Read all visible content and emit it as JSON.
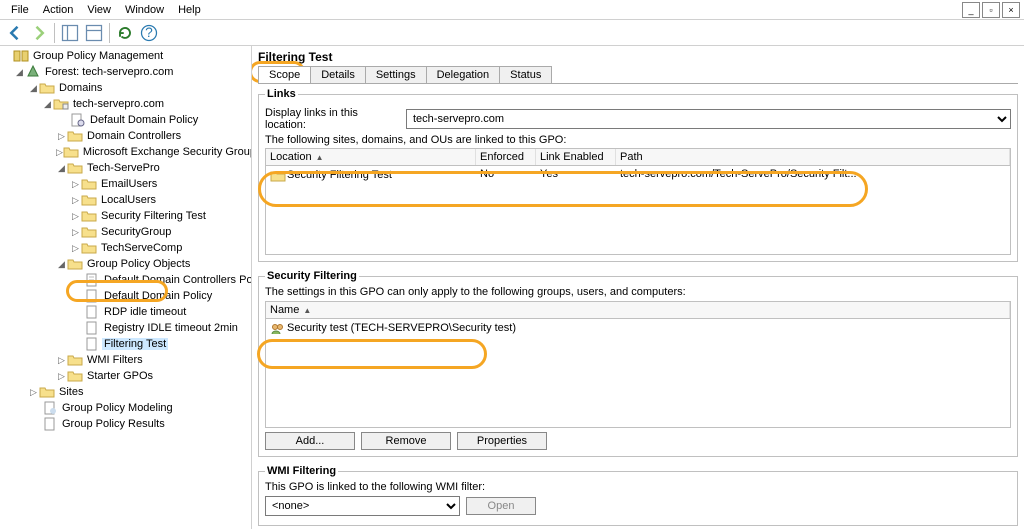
{
  "menu": {
    "file": "File",
    "action": "Action",
    "view": "View",
    "window": "Window",
    "help": "Help"
  },
  "tree": {
    "root": "Group Policy Management",
    "forest": "Forest: tech-servepro.com",
    "domains": "Domains",
    "domain": "tech-servepro.com",
    "default_policy": "Default Domain Policy",
    "dc": "Domain Controllers",
    "mesg": "Microsoft Exchange Security Groups",
    "techservepro": "Tech-ServePro",
    "emailusers": "EmailUsers",
    "localusers": "LocalUsers",
    "sft": "Security Filtering Test",
    "securitygroup": "SecurityGroup",
    "techservecomp": "TechServeComp",
    "gpo": "Group Policy Objects",
    "gpo_ddcp": "Default Domain Controllers Policy",
    "gpo_ddp": "Default Domain Policy",
    "gpo_rdp": "RDP idle timeout",
    "gpo_reg": "Registry IDLE timeout 2min",
    "gpo_filtering": "Filtering Test",
    "wmi": "WMI Filters",
    "starter": "Starter GPOs",
    "sites": "Sites",
    "gpm": "Group Policy Modeling",
    "gpr": "Group Policy Results"
  },
  "page": {
    "title": "Filtering Test",
    "tabs": {
      "scope": "Scope",
      "details": "Details",
      "settings": "Settings",
      "delegation": "Delegation",
      "status": "Status"
    },
    "links": {
      "legend": "Links",
      "label": "Display links in this location:",
      "location": "tech-servepro.com",
      "hint": "The following sites, domains, and OUs are linked to this GPO:",
      "cols": {
        "location": "Location",
        "enforced": "Enforced",
        "link_enabled": "Link Enabled",
        "path": "Path"
      },
      "row": {
        "location": "Security Filtering Test",
        "enforced": "No",
        "link_enabled": "Yes",
        "path": "tech-servepro.com/Tech-ServePro/Security Filt..."
      }
    },
    "secfilt": {
      "legend": "Security Filtering",
      "hint": "The settings in this GPO can only apply to the following groups, users, and computers:",
      "col_name": "Name",
      "row": "Security test (TECH-SERVEPRO\\Security test)",
      "add": "Add...",
      "remove": "Remove",
      "properties": "Properties"
    },
    "wmi": {
      "legend": "WMI Filtering",
      "hint": "This GPO is linked to the following WMI filter:",
      "value": "<none>",
      "open": "Open"
    }
  }
}
